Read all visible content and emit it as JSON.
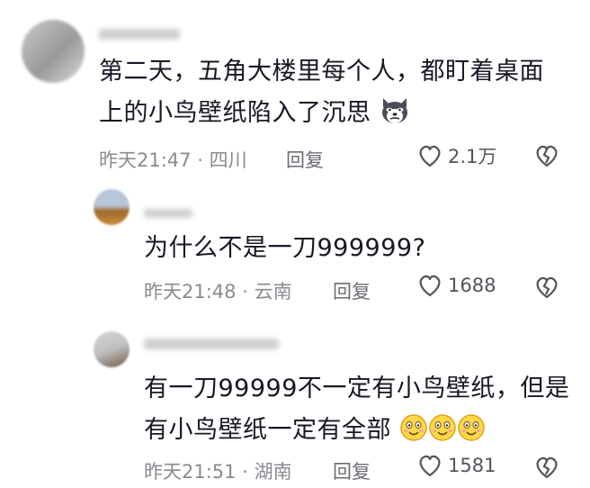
{
  "comments": [
    {
      "text_line1": "第二天，五角大楼里每个人，都盯着桌面",
      "text_line2": "上的小鸟壁纸陷入了沉思",
      "time": "昨天21:47",
      "location": "四川",
      "reply_label": "回复",
      "likes": "2.1万"
    },
    {
      "username_visible": "\"\"",
      "text": "为什么不是一刀999999?",
      "time": "昨天21:48",
      "location": "云南",
      "reply_label": "回复",
      "likes": "1688"
    },
    {
      "text_line1": "有一刀99999不一定有小鸟壁纸，但是",
      "text_line2": "有小鸟壁纸一定有全部",
      "time": "昨天21:51",
      "location": "湖南",
      "reply_label": "回复",
      "likes": "1581"
    }
  ],
  "separator": "·",
  "icons": {
    "like": "heart-outline-icon",
    "dislike": "broken-heart-icon",
    "husky": "husky-emoji-icon",
    "smile": "smile-emoji-icon"
  },
  "colors": {
    "text": "#161823",
    "meta": "#8a8b91",
    "icon": "#6b6c73"
  }
}
